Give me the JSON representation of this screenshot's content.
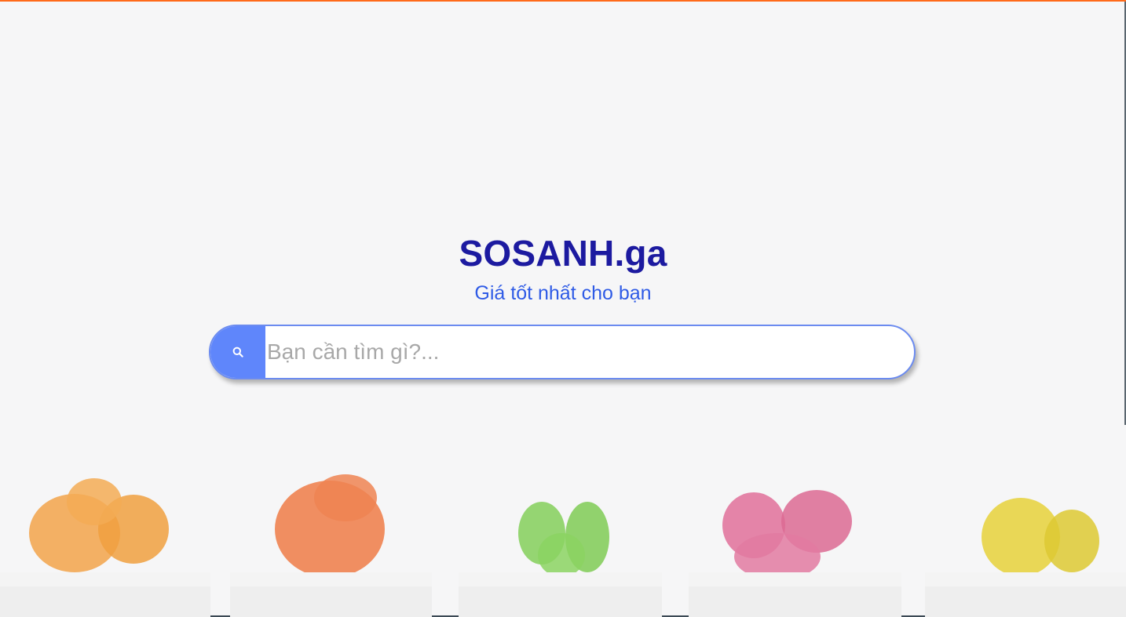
{
  "header": {
    "title": "SOSANH.ga",
    "subtitle": "Giá tốt nhất cho bạn"
  },
  "search": {
    "placeholder": "Bạn cần tìm gì?...",
    "value": "",
    "icon": "search-icon"
  },
  "colors": {
    "accent_top_bar": "#ff6a1a",
    "title": "#1c1aa0",
    "subtitle": "#2f5be6",
    "search_button": "#5f86fb",
    "search_border": "#6b8bf0"
  },
  "background": {
    "plants": [
      {
        "name": "orange-cactus",
        "color": "#f2a34a"
      },
      {
        "name": "red-orange-cactus",
        "color": "#ee7b47"
      },
      {
        "name": "green-cactus",
        "color": "#84cf5a"
      },
      {
        "name": "pink-cactus",
        "color": "#e0709a"
      },
      {
        "name": "yellow-cactus",
        "color": "#e6d13a"
      }
    ]
  }
}
